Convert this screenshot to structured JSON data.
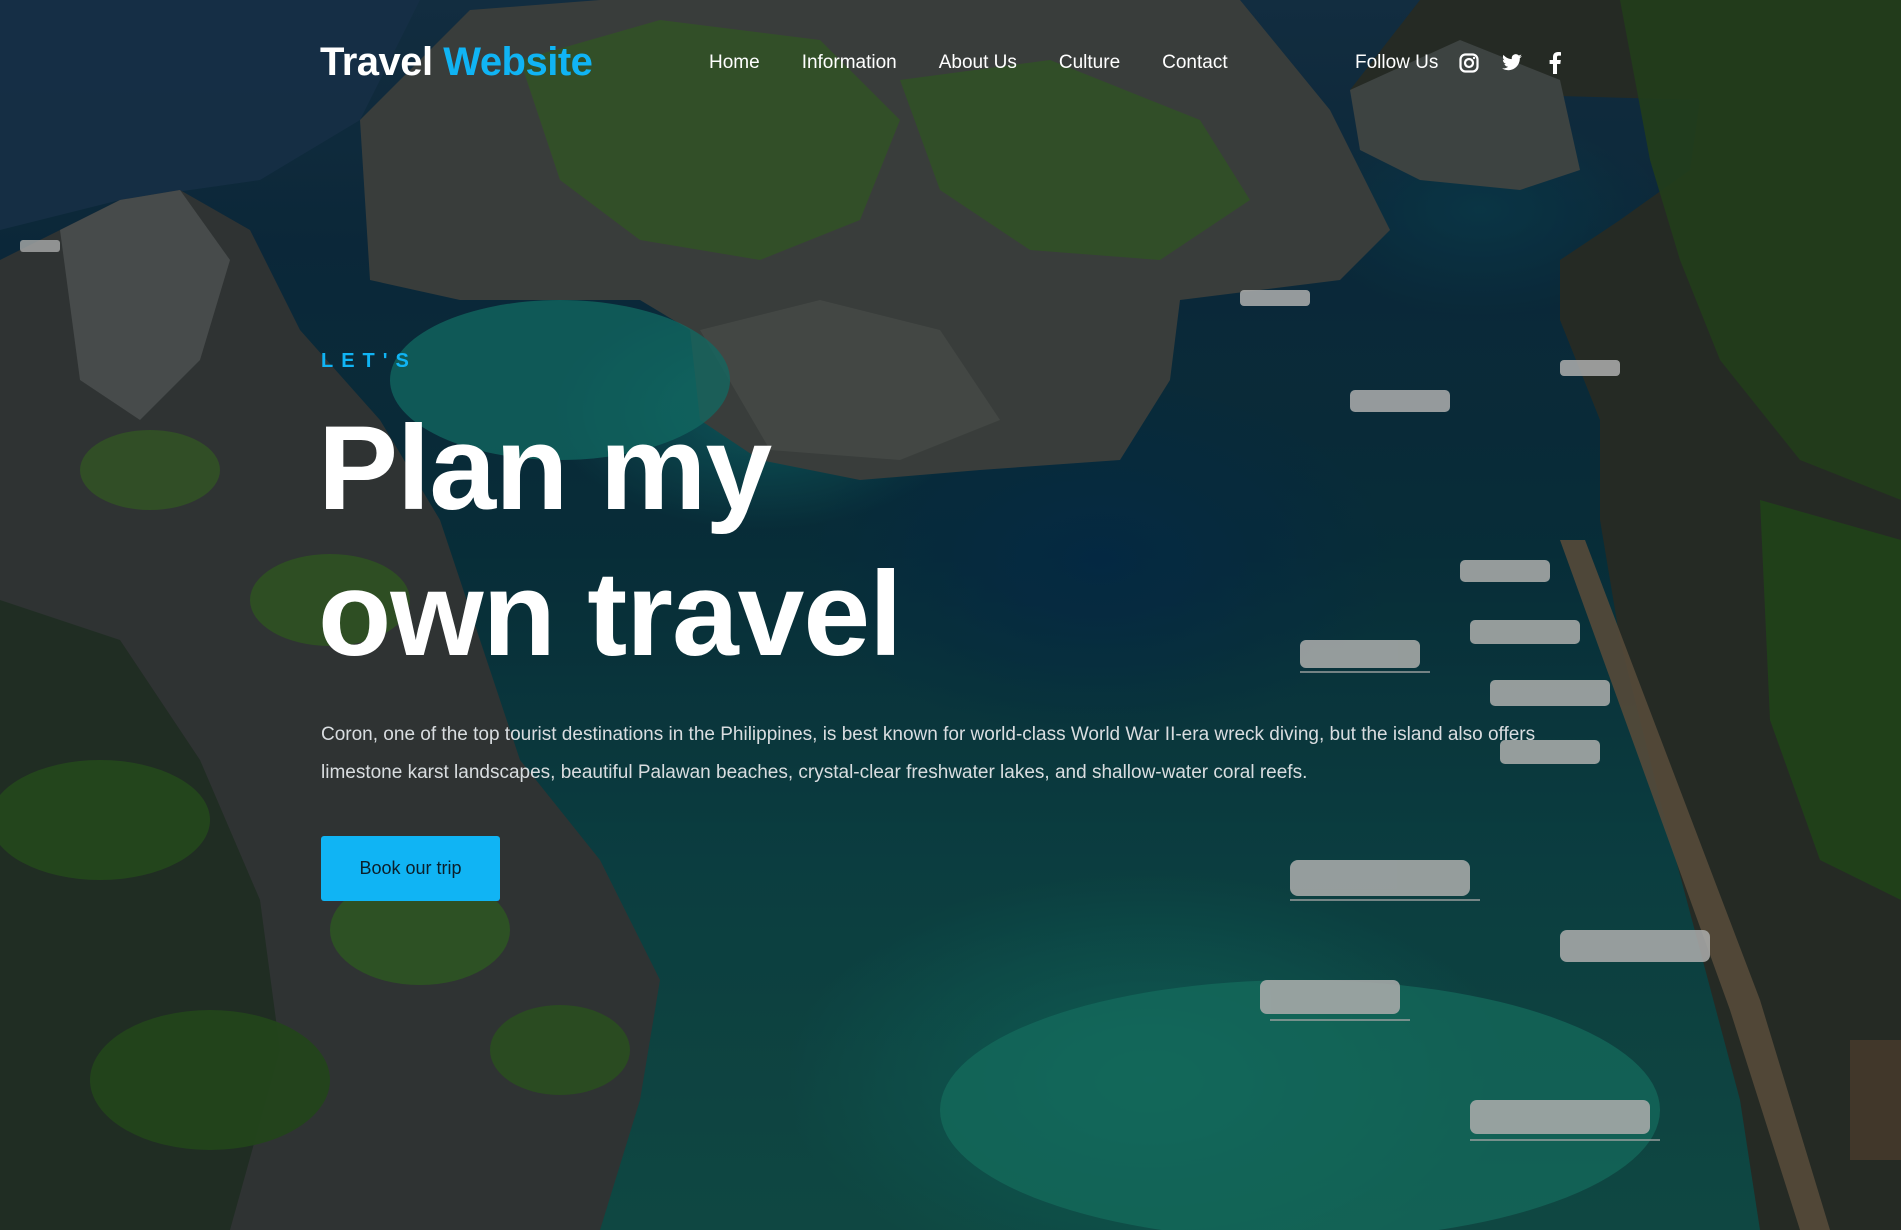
{
  "header": {
    "logo_main": "Travel",
    "logo_accent": "Website"
  },
  "nav": {
    "items": [
      {
        "label": "Home"
      },
      {
        "label": "Information"
      },
      {
        "label": "About Us"
      },
      {
        "label": "Culture"
      },
      {
        "label": "Contact"
      }
    ]
  },
  "social": {
    "label": "Follow Us",
    "icons": [
      "instagram-icon",
      "twitter-icon",
      "facebook-icon"
    ]
  },
  "hero": {
    "kicker": "LET'S",
    "headline_line1": "Plan my",
    "headline_line2": "own travel",
    "description": "Coron, one of the top tourist destinations in the Philippines, is best known for world-class World War II-era wreck diving, but the island also offers limestone karst landscapes, beautiful Palawan beaches, crystal-clear freshwater lakes, and shallow-water coral reefs.",
    "cta_label": "Book our trip"
  },
  "colors": {
    "accent": "#10b4f4",
    "text": "#ffffff",
    "muted_text": "#d9dde0"
  }
}
